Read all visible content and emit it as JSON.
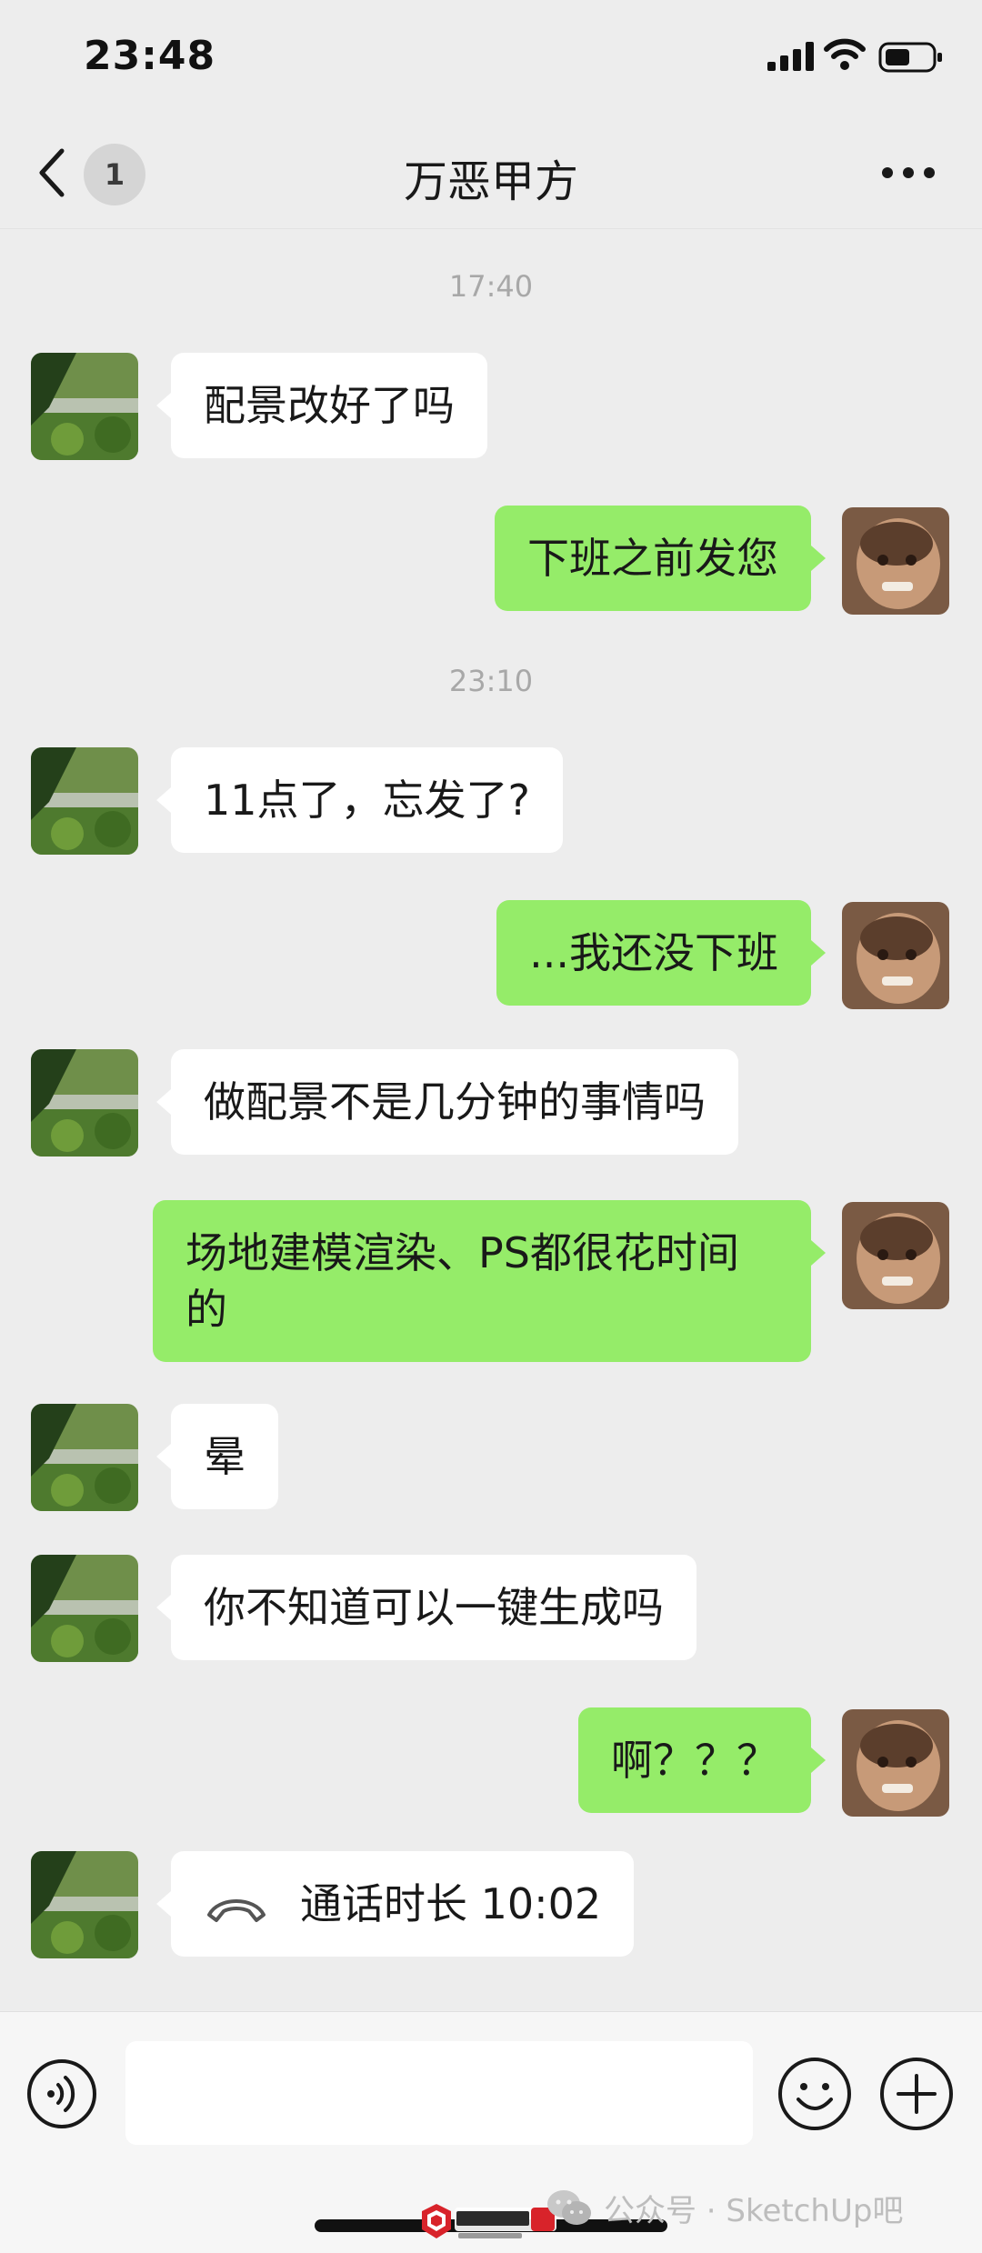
{
  "status_bar": {
    "time": "23:48"
  },
  "nav": {
    "unread_count": "1",
    "title": "万恶甲方"
  },
  "messages": [
    {
      "type": "time",
      "text": "17:40"
    },
    {
      "type": "in",
      "text": "配景改好了吗"
    },
    {
      "type": "out",
      "text": "下班之前发您"
    },
    {
      "type": "time",
      "text": "23:10"
    },
    {
      "type": "in",
      "text": "11点了，忘发了?"
    },
    {
      "type": "out",
      "text": "...我还没下班"
    },
    {
      "type": "in",
      "text": "做配景不是几分钟的事情吗"
    },
    {
      "type": "out",
      "text": "场地建模渲染、PS都很花时间的"
    },
    {
      "type": "in",
      "text": "晕"
    },
    {
      "type": "in",
      "text": "你不知道可以一键生成吗"
    },
    {
      "type": "out",
      "text": "啊？？？"
    },
    {
      "type": "in_call",
      "text": "通话时长 10:02"
    }
  ],
  "watermark": {
    "text": "公众号 · SketchUp吧",
    "logo_text": "SketchUp吧"
  },
  "colors": {
    "background": "#ededed",
    "outgoing_bubble": "#95ec69",
    "incoming_bubble": "#ffffff",
    "timestamp": "#a8a8a8"
  }
}
